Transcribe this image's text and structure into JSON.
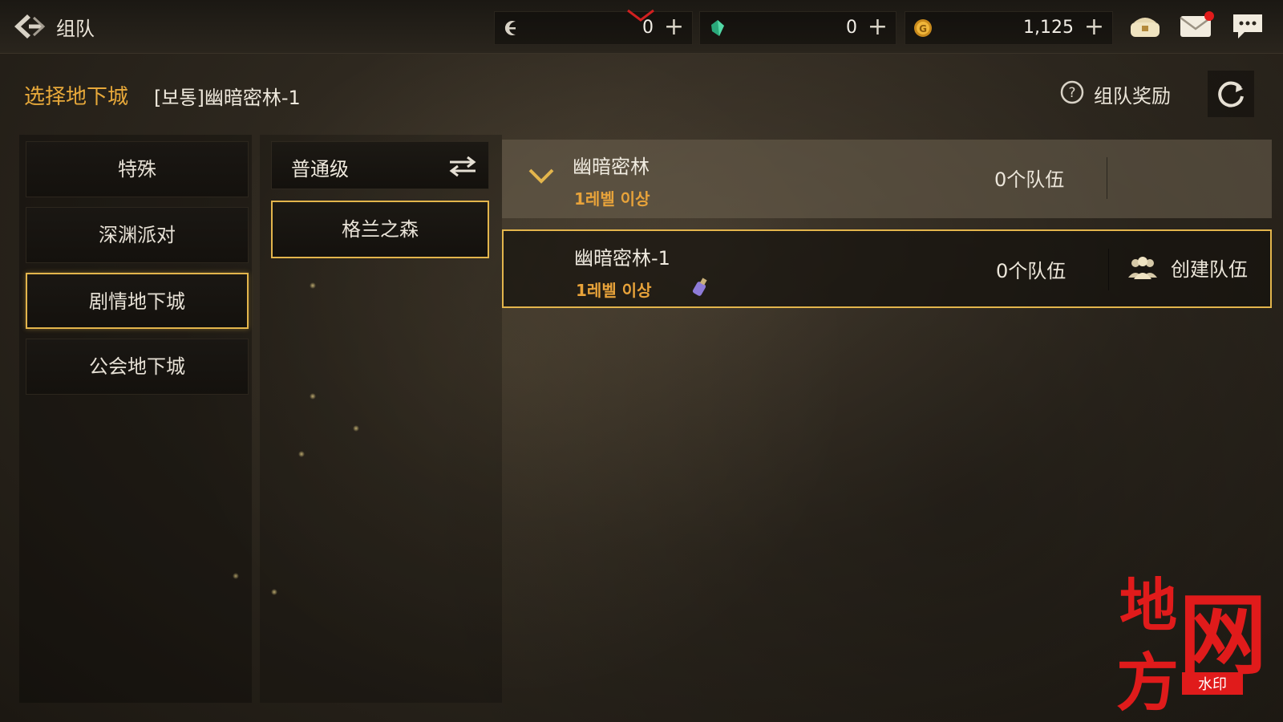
{
  "header": {
    "title": "组队",
    "currencies": [
      {
        "icon": "crescent-coin-icon",
        "value": "0"
      },
      {
        "icon": "green-gem-icon",
        "value": "0"
      },
      {
        "icon": "gold-coin-icon",
        "value": "1,125"
      }
    ],
    "plus": "+",
    "icons": [
      "chest-icon",
      "mail-icon",
      "chat-icon"
    ]
  },
  "section": {
    "label": "选择地下城",
    "selected_dungeon": "[보통]幽暗密林-1",
    "reward_label": "组队奖励"
  },
  "categories": [
    {
      "label": "特殊"
    },
    {
      "label": "深渊派对"
    },
    {
      "label": "剧情地下城"
    },
    {
      "label": "公会地下城"
    }
  ],
  "difficulty": {
    "label": "普通级"
  },
  "area": {
    "label": "格兰之森"
  },
  "rows": [
    {
      "name": "幽暗密林",
      "level": "1레벨 이상",
      "teams": "0个队伍"
    },
    {
      "name": "幽暗密林-1",
      "level": "1레벨 이상",
      "teams": "0个队伍",
      "action": "创建队伍"
    }
  ],
  "watermark": {
    "line1": "地",
    "line2": "方",
    "net": "网",
    "sub": "水印"
  },
  "colors": {
    "accent": "#e3b54c",
    "orange": "#e8a33a",
    "red": "#e01b1b"
  }
}
